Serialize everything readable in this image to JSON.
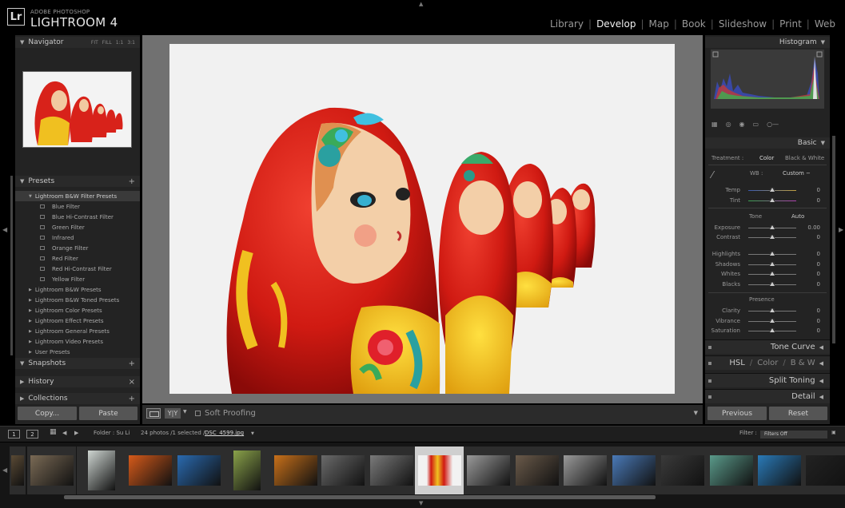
{
  "app": {
    "brand_small": "ADOBE PHOTOSHOP",
    "brand_big": "LIGHTROOM 4",
    "logo": "Lr",
    "modules": [
      "Library",
      "Develop",
      "Map",
      "Book",
      "Slideshow",
      "Print",
      "Web"
    ],
    "active_module": "Develop"
  },
  "left": {
    "navigator": {
      "title": "Navigator",
      "opts": [
        "FIT",
        "FILL",
        "1:1",
        "3:1"
      ]
    },
    "presets": {
      "title": "Presets",
      "rows": [
        {
          "label": "Lightroom B&W Filter Presets",
          "kind": "group-open"
        },
        {
          "label": "Blue Filter",
          "kind": "child"
        },
        {
          "label": "Blue Hi-Contrast Filter",
          "kind": "child"
        },
        {
          "label": "Green Filter",
          "kind": "child"
        },
        {
          "label": "Infrared",
          "kind": "child"
        },
        {
          "label": "Orange Filter",
          "kind": "child"
        },
        {
          "label": "Red Filter",
          "kind": "child"
        },
        {
          "label": "Red Hi-Contrast Filter",
          "kind": "child"
        },
        {
          "label": "Yellow Filter",
          "kind": "child"
        },
        {
          "label": "Lightroom B&W Presets",
          "kind": "group"
        },
        {
          "label": "Lightroom B&W Toned Presets",
          "kind": "group"
        },
        {
          "label": "Lightroom Color Presets",
          "kind": "group"
        },
        {
          "label": "Lightroom Effect Presets",
          "kind": "group"
        },
        {
          "label": "Lightroom General Presets",
          "kind": "group"
        },
        {
          "label": "Lightroom Video Presets",
          "kind": "group"
        },
        {
          "label": "User Presets",
          "kind": "group"
        }
      ]
    },
    "snapshots": "Snapshots",
    "history": "History",
    "collections": "Collections",
    "copy_btn": "Copy...",
    "paste_btn": "Paste"
  },
  "toolbar": {
    "yy": "Y|Y",
    "soft_proofing": "Soft Proofing"
  },
  "right": {
    "histogram": "Histogram",
    "basic": "Basic",
    "treatment_label": "Treatment :",
    "treatment_color": "Color",
    "treatment_bw": "Black & White",
    "wb_label": "WB :",
    "wb_value": "Custom −",
    "tone_label": "Tone",
    "auto_label": "Auto",
    "presence_label": "Presence",
    "sliders_wb": [
      {
        "label": "Temp",
        "value": "0",
        "pos": 0.5
      },
      {
        "label": "Tint",
        "value": "0",
        "pos": 0.5
      }
    ],
    "sliders_tone1": [
      {
        "label": "Exposure",
        "value": "0.00",
        "pos": 0.5
      },
      {
        "label": "Contrast",
        "value": "0",
        "pos": 0.5
      }
    ],
    "sliders_tone2": [
      {
        "label": "Highlights",
        "value": "0",
        "pos": 0.5
      },
      {
        "label": "Shadows",
        "value": "0",
        "pos": 0.5
      },
      {
        "label": "Whites",
        "value": "0",
        "pos": 0.5
      },
      {
        "label": "Blacks",
        "value": "0",
        "pos": 0.5
      }
    ],
    "sliders_presence": [
      {
        "label": "Clarity",
        "value": "0",
        "pos": 0.5
      },
      {
        "label": "Vibrance",
        "value": "0",
        "pos": 0.5
      },
      {
        "label": "Saturation",
        "value": "0",
        "pos": 0.5
      }
    ],
    "tone_curve": "Tone Curve",
    "hsl": "HSL",
    "color": "Color",
    "bw": "B & W",
    "split_toning": "Split Toning",
    "detail": "Detail",
    "previous_btn": "Previous",
    "reset_btn": "Reset"
  },
  "filmbar": {
    "page1": "1",
    "page2": "2",
    "folder": "Folder : Su Li",
    "count": "24 photos /1 selected /",
    "filename": "DSC_4599.jpg",
    "filter_label": "Filter :",
    "filter_value": "Filters Off"
  },
  "filmstrip_colors": [
    "#5a4a35",
    "#7a6a55",
    "#cfd6d2",
    "#d65a1a",
    "#2a6ab0",
    "#8aa24a",
    "#c8701a",
    "#6a6a6a",
    "#7a7a7a",
    "#c8301a",
    "#9a9a9a",
    "#6a5a4a",
    "#9a9a9a",
    "#4a7ab8",
    "#3a3a3a",
    "#5a9a8a",
    "#2a7ab8",
    "#222222"
  ]
}
